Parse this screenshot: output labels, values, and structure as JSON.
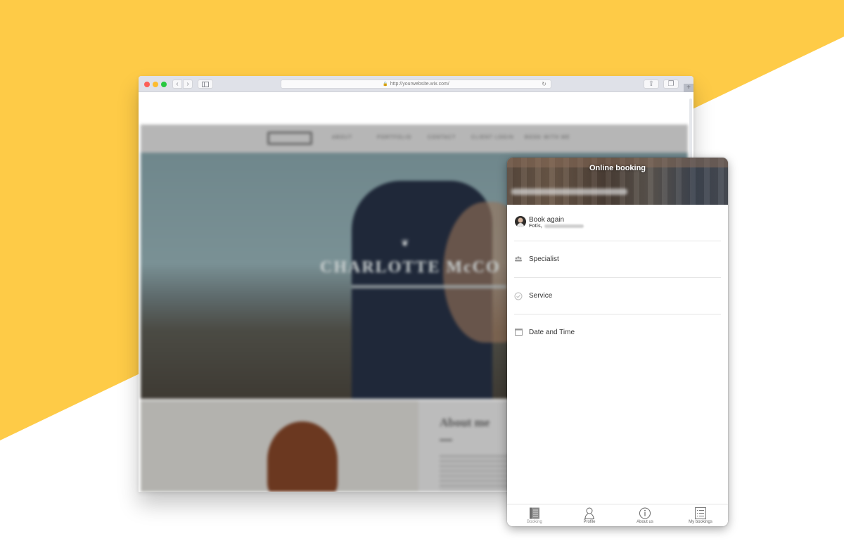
{
  "background": {
    "accent_color": "#FECB47"
  },
  "browser": {
    "address_url": "http://yourwebsite.wix.com/",
    "new_tab_label": "+",
    "back_label": "‹",
    "forward_label": "›",
    "reload_label": "↻",
    "share_label": "⇪",
    "tabs_label": "❐",
    "lock_label": "🔒"
  },
  "website": {
    "nav_items": [
      "ABOUT",
      "PORTFOLIO",
      "CONTACT",
      "CLIENT LOGIN",
      "BOOK WITH ME"
    ],
    "hero_title": "CHARLOTTE McCO",
    "hero_mark": "❦",
    "about_title": "About me"
  },
  "widget": {
    "title": "Online booking",
    "rows": [
      {
        "label": "Book again",
        "sub": "Fotis,",
        "icon": "avatar"
      },
      {
        "label": "Specialist",
        "icon": "people-icon"
      },
      {
        "label": "Service",
        "icon": "check-circle-icon"
      },
      {
        "label": "Date and Time",
        "icon": "calendar-icon"
      }
    ],
    "tabs": [
      {
        "label": "Booking",
        "icon": "booking-icon",
        "active": true
      },
      {
        "label": "Profile",
        "icon": "profile-icon",
        "active": false
      },
      {
        "label": "About us",
        "icon": "info-icon",
        "active": false
      },
      {
        "label": "My bookings",
        "icon": "list-icon",
        "active": false
      }
    ]
  }
}
